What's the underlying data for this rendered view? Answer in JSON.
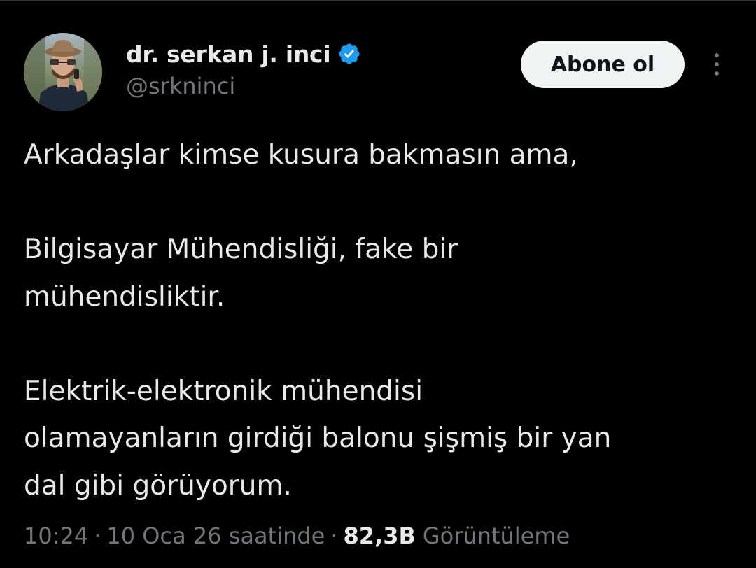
{
  "author": {
    "name": "dr. serkan j. inci",
    "handle": "@srkninci",
    "verified": true,
    "verified_color": "#1d9bf0",
    "avatar_icon": "profile-photo"
  },
  "actions": {
    "follow_label": "Abone ol",
    "more_icon": "more-vertical-icon"
  },
  "tweet": {
    "paragraphs": [
      [
        "Arkadaşlar kimse kusura bakmasın ama,"
      ],
      [
        "Bilgisayar Mühendisliği, fake bir",
        "mühendisliktir."
      ],
      [
        "Elektrik-elektronik mühendisi",
        "olamayanların girdiği balonu şişmiş bir yan",
        "dal gibi görüyorum."
      ]
    ]
  },
  "meta": {
    "time": "10:24",
    "date": "10 Oca 26 saatinde",
    "separator": "·",
    "views_count": "82,3B",
    "views_label": "Görüntüleme"
  },
  "colors": {
    "background": "#000000",
    "text_primary": "#e7e9ea",
    "text_secondary": "#71767b",
    "button_bg": "#eff3f4",
    "button_text": "#0f1419"
  }
}
